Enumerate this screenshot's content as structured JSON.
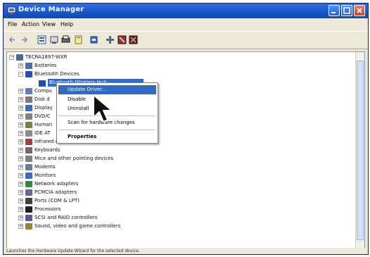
{
  "window": {
    "title": "Device Manager",
    "controls": {
      "minimize": "minimize",
      "maximize": "maximize",
      "close": "close"
    }
  },
  "menubar": [
    "File",
    "Action",
    "View",
    "Help"
  ],
  "toolbar_icons": [
    "back-icon",
    "forward-icon",
    "properties-icon",
    "refresh-icon",
    "print-icon",
    "help-icon",
    "update-driver-icon",
    "scan-icon",
    "disable-icon",
    "uninstall-icon"
  ],
  "tree": {
    "root": "TECRA1897-WXR",
    "items": [
      {
        "label": "Batteries",
        "icon_color": "#4a6fb0",
        "expander": "+"
      },
      {
        "label": "Bluetooth Devices",
        "icon_color": "#1f4fb8",
        "expander": "-"
      },
      {
        "label": "Bluetooth Wireless Hub",
        "icon_color": "#1f4fb8",
        "expander": ""
      },
      {
        "label": "Compu",
        "icon_color": "#5a7fc0",
        "expander": "+"
      },
      {
        "label": "Disk d",
        "icon_color": "#7a7a7a",
        "expander": "+"
      },
      {
        "label": "Display",
        "icon_color": "#3a6ac8",
        "expander": "+"
      },
      {
        "label": "DVD/C",
        "icon_color": "#808080",
        "expander": "+"
      },
      {
        "label": "Human",
        "icon_color": "#6a8a40",
        "expander": "+"
      },
      {
        "label": "IDE AT",
        "icon_color": "#8a8a8a",
        "expander": "+"
      },
      {
        "label": "Infrared devices",
        "icon_color": "#a04040",
        "expander": "+"
      },
      {
        "label": "Keyboards",
        "icon_color": "#6a6a6a",
        "expander": "+"
      },
      {
        "label": "Mice and other pointing devices",
        "icon_color": "#808080",
        "expander": "+"
      },
      {
        "label": "Modems",
        "icon_color": "#6080a0",
        "expander": "+"
      },
      {
        "label": "Monitors",
        "icon_color": "#3a6ac8",
        "expander": "+"
      },
      {
        "label": "Network adapters",
        "icon_color": "#2f8a3a",
        "expander": "+"
      },
      {
        "label": "PCMCIA adapters",
        "icon_color": "#7060a0",
        "expander": "+"
      },
      {
        "label": "Ports (COM & LPT)",
        "icon_color": "#404040",
        "expander": "+"
      },
      {
        "label": "Processors",
        "icon_color": "#202020",
        "expander": "+"
      },
      {
        "label": "SCSI and RAID controllers",
        "icon_color": "#5a5a8a",
        "expander": "+"
      },
      {
        "label": "Sound, video and game controllers",
        "icon_color": "#a08030",
        "expander": "+"
      }
    ]
  },
  "context_menu": {
    "items": [
      "Update Driver...",
      "Disable",
      "Uninstall",
      "Scan for hardware changes",
      "Properties"
    ],
    "highlighted_index": 0
  },
  "statusbar": {
    "text": "Launches the Hardware Update Wizard for the selected device."
  },
  "colors": {
    "titlebar": "#1a55c8",
    "selection": "#316ac5",
    "chrome": "#ece9d8"
  }
}
